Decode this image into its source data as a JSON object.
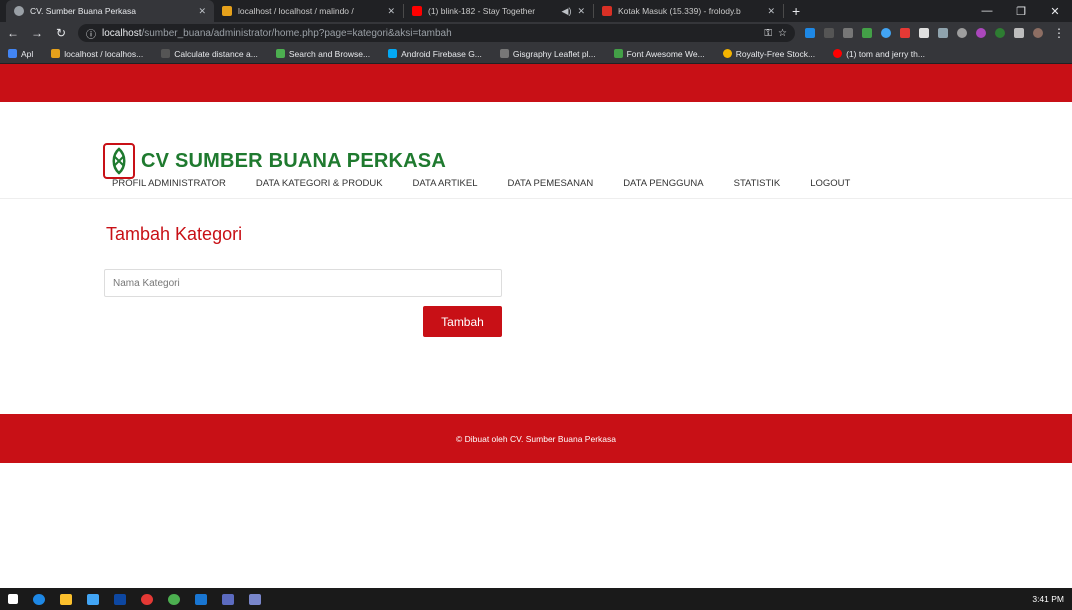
{
  "browser": {
    "tabs": [
      {
        "title": "CV. Sumber Buana Perkasa",
        "color": "#9aa0a6"
      },
      {
        "title": "localhost / localhost / malindo /",
        "color": "#e6a11b"
      },
      {
        "title": "(1) blink-182 - Stay Together",
        "color": "#ff0000"
      },
      {
        "title": "Kotak Masuk (15.339) - frolody.b",
        "color": "#d93025"
      }
    ],
    "newtab": "+",
    "url_host": "localhost",
    "url_path": "/sumber_buana/administrator/home.php?page=kategori&aksi=tambah",
    "bookmarks": [
      {
        "label": "Apl",
        "color": "#4285f4"
      },
      {
        "label": "localhost / localhos...",
        "color": "#e6a11b"
      },
      {
        "label": "Calculate distance a...",
        "color": "#555"
      },
      {
        "label": "Search and Browse...",
        "color": "#4caf50"
      },
      {
        "label": "Android Firebase G...",
        "color": "#03a9f4"
      },
      {
        "label": "Gisgraphy Leaflet pl...",
        "color": "#777"
      },
      {
        "label": "Font Awesome We...",
        "color": "#43a047"
      },
      {
        "label": "Royalty-Free Stock...",
        "color": "#f4b400"
      },
      {
        "label": "(1) tom and jerry th...",
        "color": "#ff0000"
      }
    ]
  },
  "site": {
    "brand": "CV SUMBER BUANA PERKASA",
    "nav": [
      "PROFIL ADMINISTRATOR",
      "DATA KATEGORI & PRODUK",
      "DATA ARTIKEL",
      "DATA PEMESANAN",
      "DATA PENGGUNA",
      "STATISTIK",
      "LOGOUT"
    ],
    "heading": "Tambah Kategori",
    "input_placeholder": "Nama Kategori",
    "submit_label": "Tambah",
    "footer": "© Dibuat oleh CV. Sumber Buana Perkasa"
  },
  "taskbar": {
    "clock": "3:41 PM"
  },
  "colors": {
    "accent": "#c81016",
    "brand_green": "#1f7a2f"
  }
}
